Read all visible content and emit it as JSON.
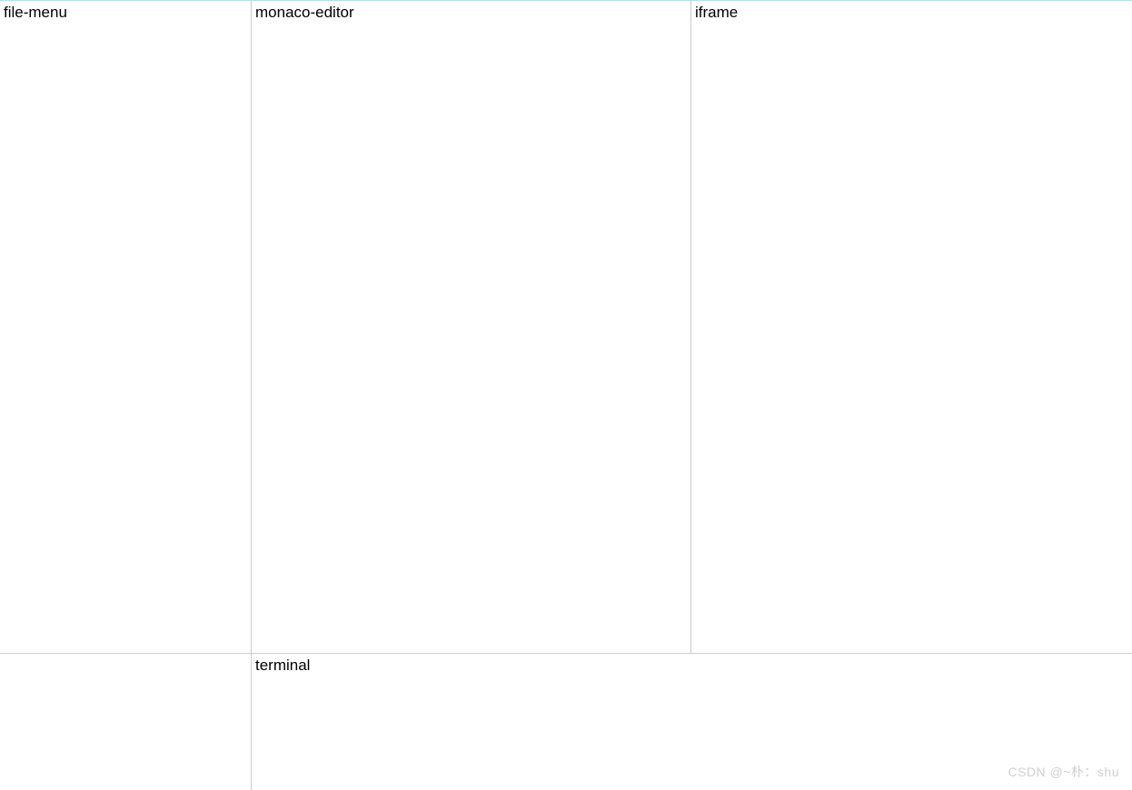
{
  "panels": {
    "file_menu": {
      "label": "file-menu"
    },
    "monaco_editor": {
      "label": "monaco-editor"
    },
    "iframe": {
      "label": "iframe"
    },
    "terminal": {
      "label": "terminal"
    }
  },
  "watermark": "CSDN @~朴：shu"
}
